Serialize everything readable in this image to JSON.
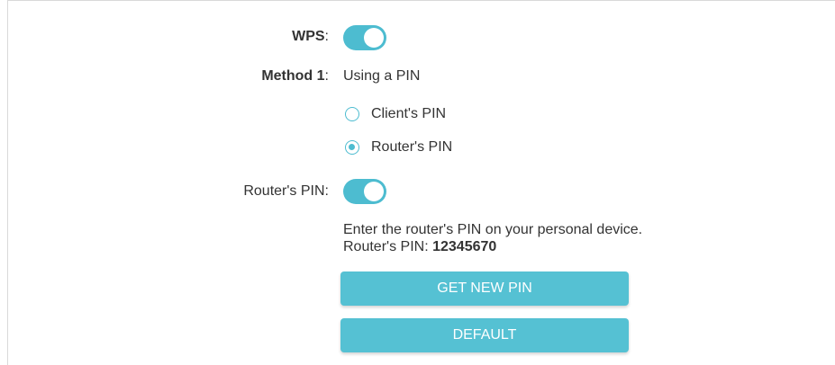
{
  "wps": {
    "label": "WPS",
    "enabled": true
  },
  "method1": {
    "label": "Method 1",
    "value": "Using a PIN",
    "options": [
      {
        "label": "Client's PIN",
        "selected": false
      },
      {
        "label": "Router's PIN",
        "selected": true
      }
    ]
  },
  "router_pin": {
    "label": "Router's PIN",
    "enabled": true,
    "instruction": "Enter the router's PIN on your personal device.",
    "pin_label": "Router's PIN: ",
    "pin_value": "12345670"
  },
  "buttons": {
    "get_new_pin": "GET NEW PIN",
    "default": "DEFAULT"
  },
  "colors": {
    "accent": "#4dbcd0",
    "button": "#55c1d3",
    "text": "#333333",
    "border": "#d9d9d9"
  }
}
